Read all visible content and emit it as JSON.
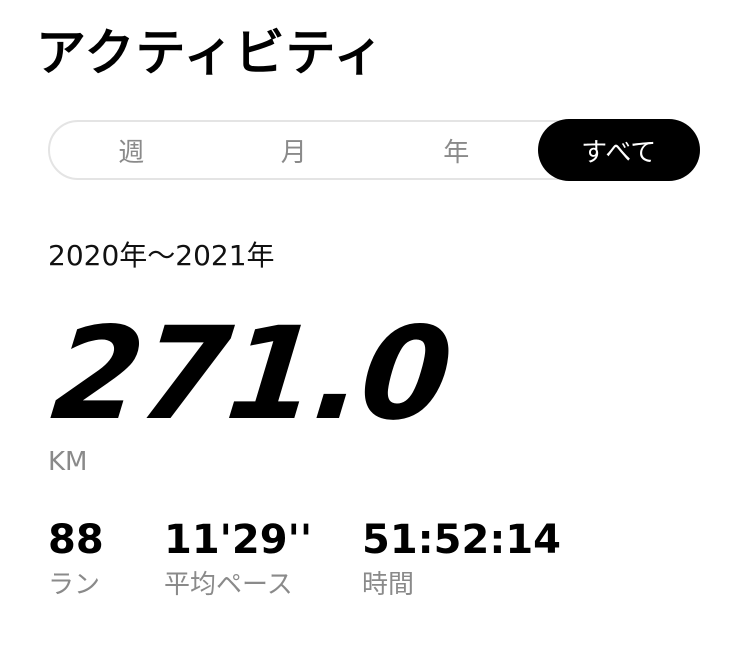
{
  "page": {
    "title": "アクティビティ"
  },
  "period_tabs": [
    {
      "label": "週",
      "active": false
    },
    {
      "label": "月",
      "active": false
    },
    {
      "label": "年",
      "active": false
    },
    {
      "label": "すべて",
      "active": true
    }
  ],
  "summary": {
    "date_range": "2020年〜2021年",
    "total_distance": "271.0",
    "distance_unit": "KM"
  },
  "stats": [
    {
      "value": "88",
      "label": "ラン"
    },
    {
      "value": "11'29''",
      "label": "平均ペース"
    },
    {
      "value": "51:52:14",
      "label": "時間"
    }
  ],
  "colors": {
    "text_primary": "#000000",
    "text_secondary": "#8a8a8a",
    "tab_active_bg": "#000000",
    "tab_active_text": "#ffffff",
    "tab_border": "#e4e4e4",
    "background": "#ffffff"
  }
}
